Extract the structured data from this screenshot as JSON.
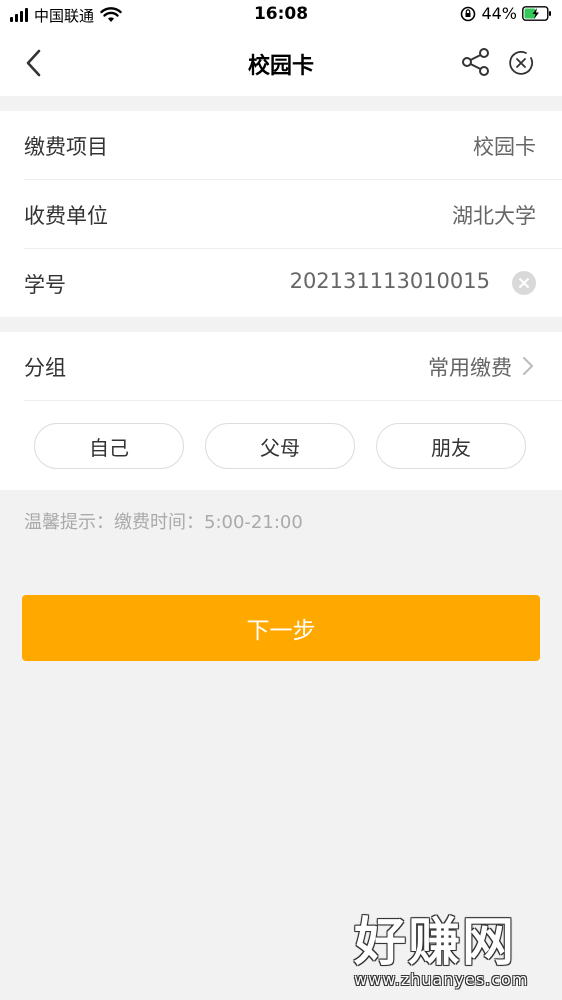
{
  "status_bar": {
    "carrier": "中国联通",
    "time": "16:08",
    "battery": "44%"
  },
  "nav": {
    "title": "校园卡"
  },
  "form": {
    "rows": [
      {
        "label": "缴费项目",
        "value": "校园卡"
      },
      {
        "label": "收费单位",
        "value": "湖北大学"
      },
      {
        "label": "学号",
        "value": "202131113010015"
      }
    ]
  },
  "group": {
    "label": "分组",
    "value": "常用缴费",
    "chips": [
      "自己",
      "父母",
      "朋友"
    ]
  },
  "tip": "温馨提示：缴费时间：5:00-21:00",
  "next_button": "下一步",
  "watermark": {
    "main": "好赚网",
    "sub": "www.zhuanyes.com"
  },
  "colors": {
    "accent": "#ffa800",
    "background": "#f2f2f2"
  }
}
